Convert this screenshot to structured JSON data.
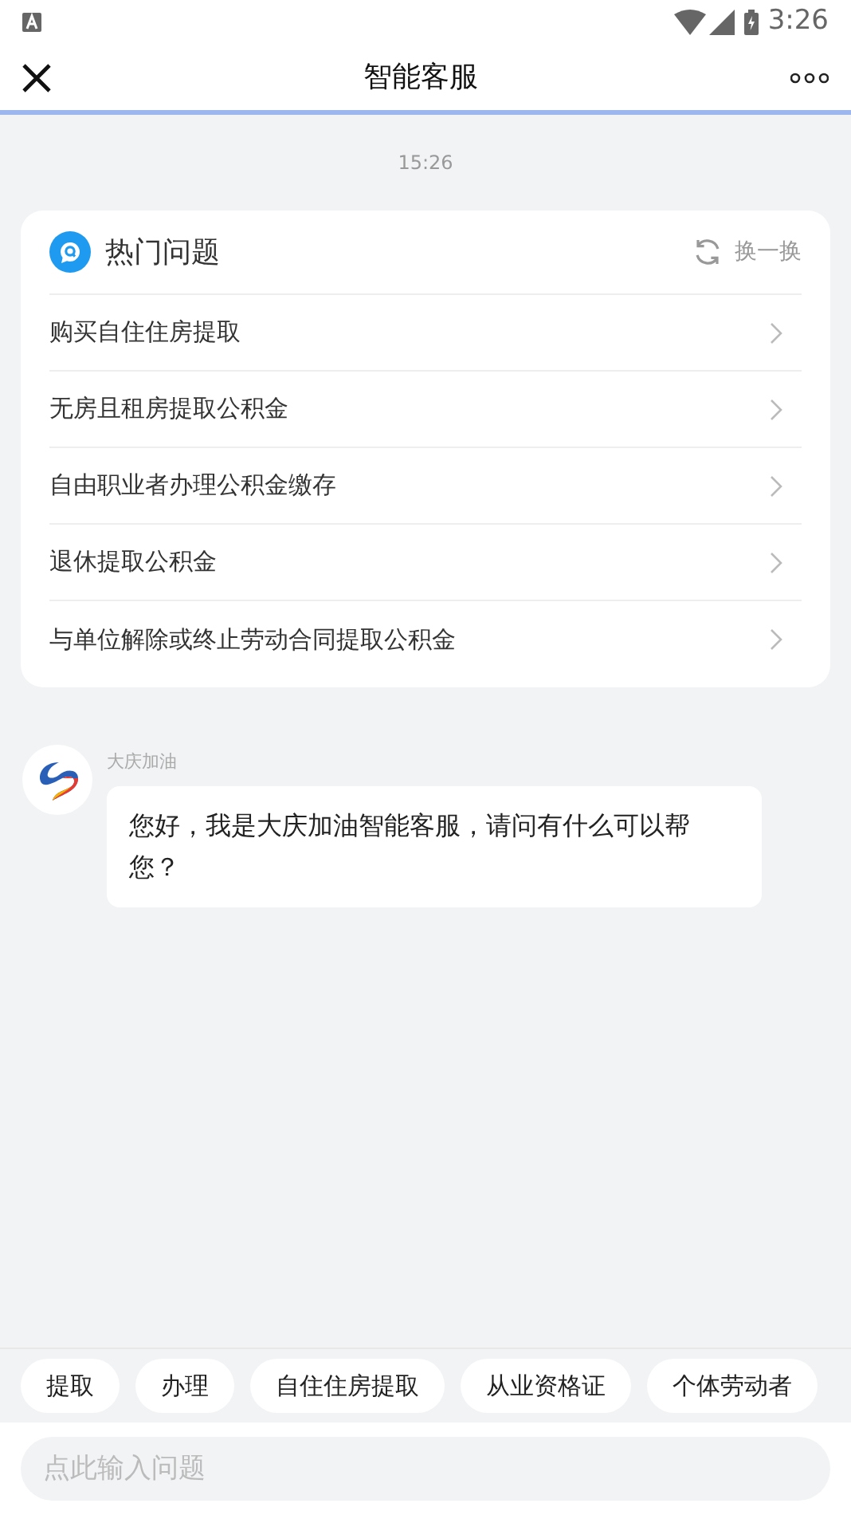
{
  "status_bar": {
    "time": "3:26"
  },
  "header": {
    "title": "智能客服"
  },
  "chat": {
    "timestamp": "15:26",
    "hot_questions": {
      "title": "热门问题",
      "refresh_label": "换一换",
      "items": [
        {
          "text": "购买自住住房提取"
        },
        {
          "text": "无房且租房提取公积金"
        },
        {
          "text": "自由职业者办理公积金缴存"
        },
        {
          "text": "退休提取公积金"
        },
        {
          "text": "与单位解除或终止劳动合同提取公积金"
        }
      ]
    },
    "messages": [
      {
        "sender": "大庆加油",
        "text": "您好，我是大庆加油智能客服，请问有什么可以帮您？"
      }
    ]
  },
  "quick_replies": [
    "提取",
    "办理",
    "自住住房提取",
    "从业资格证",
    "个体劳动者"
  ],
  "input": {
    "placeholder": "点此输入问题"
  }
}
